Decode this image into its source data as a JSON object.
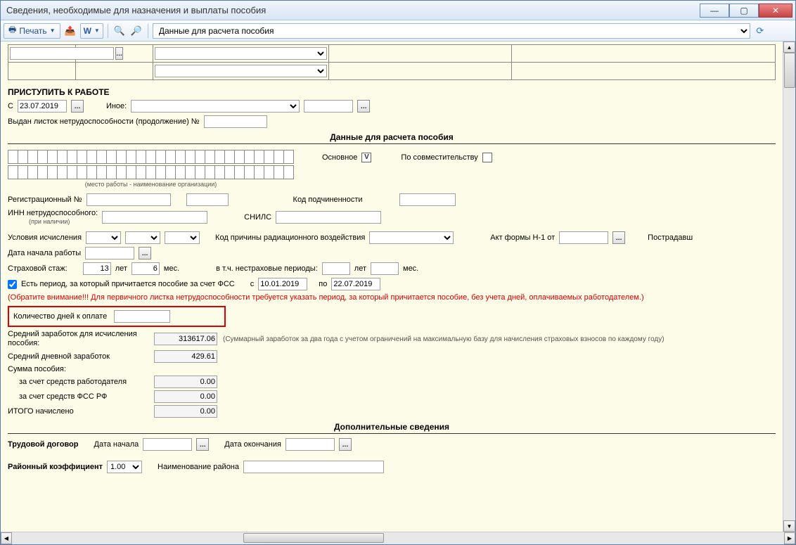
{
  "window": {
    "title": "Сведения, необходимые для назначения и выплаты пособия"
  },
  "toolbar": {
    "print": "Печать",
    "dropdown_selected": "Данные для расчета пособия"
  },
  "return_to_work": {
    "heading": "ПРИСТУПИТЬ К РАБОТЕ",
    "from_label": "С",
    "from_date": "23.07.2019",
    "other_label": "Иное:",
    "cont_label": "Выдан листок нетрудоспособности (продолжение) №"
  },
  "calc": {
    "heading": "Данные для расчета пособия",
    "workplace_caption": "(место работы - наименование организации)",
    "primary_label": "Основное",
    "primary_checked": true,
    "secondary_label": "По совместительству",
    "secondary_checked": false,
    "reg_no_label": "Регистрационный №",
    "sub_code_label": "Код подчиненности",
    "inn_label": "ИНН нетрудоспособного:",
    "inn_caption": "(при наличии)",
    "snils_label": "СНИЛС",
    "calc_cond_label": "Условия исчисления",
    "rad_code_label": "Код причины радиационного воздействия",
    "act_label": "Акт формы Н-1 от",
    "victim_label": "Пострадавш",
    "start_date_label": "Дата начала работы",
    "ins_period_label": "Страховой стаж:",
    "ins_years": "13",
    "ins_years_unit": "лет",
    "ins_months": "6",
    "ins_months_unit": "мес.",
    "nonins_label": "в т.ч. нестраховые периоды:",
    "nonins_years_unit": "лет",
    "nonins_months_unit": "мес.",
    "fss_period_chk": true,
    "fss_period_label": "Есть период, за который причитается пособие за счет ФСС",
    "fss_from_label": "с",
    "fss_from": "10.01.2019",
    "fss_to_label": "по",
    "fss_to": "22.07.2019",
    "warning": "(Обратите внимание!!! Для первичного листка нетрудоспособности требуется указать период, за который причитается пособие, без учета дней, оплачиваемых работодателем.)",
    "days_label": "Количество дней к оплате",
    "avg_earn_label": "Средний заработок для исчисления пособия:",
    "avg_earn": "313617.06",
    "avg_earn_hint": "(Суммарный заработок за два года с учетом ограничений на максимальную базу для начисления страховых взносов по каждому году)",
    "avg_daily_label": "Средний дневной заработок",
    "avg_daily": "429.61",
    "sum_label": "Сумма пособия:",
    "employer_label": "за счет средств работодателя",
    "employer_sum": "0.00",
    "fss_label": "за счет средств ФСС РФ",
    "fss_sum": "0.00",
    "total_label": "ИТОГО начислено",
    "total_sum": "0.00"
  },
  "extra": {
    "heading": "Дополнительные сведения",
    "contract_label": "Трудовой договор",
    "start_label": "Дата начала",
    "end_label": "Дата окончания",
    "region_coef_label": "Районный коэффициент",
    "region_coef": "1.00",
    "region_name_label": "Наименование района"
  }
}
